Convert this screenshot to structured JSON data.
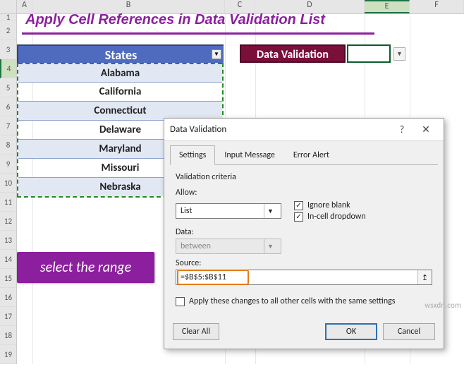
{
  "columns": [
    "A",
    "B",
    "C",
    "D",
    "E",
    "F"
  ],
  "rows": [
    "1",
    "2",
    "3",
    "4",
    "5",
    "6",
    "7",
    "8",
    "9",
    "10",
    "11",
    "12",
    "13",
    "14",
    "15",
    "16",
    "17",
    "18",
    "19"
  ],
  "selected_col": "E",
  "selected_row": "4",
  "title": "Apply Cell References in Data Validation List",
  "states": {
    "header": "States",
    "items": [
      "Alabama",
      "California",
      "Connecticut",
      "Delaware",
      "Maryland",
      "Missouri",
      "Nebraska"
    ]
  },
  "dv_label": "Data Validation",
  "range_hint": "select the range",
  "dialog": {
    "title": "Data Validation",
    "help": "?",
    "close": "✕",
    "tabs": {
      "settings": "Settings",
      "input_msg": "Input Message",
      "error_alert": "Error Alert"
    },
    "active_tab": "settings",
    "criteria_title": "Validation criteria",
    "allow_label": "Allow:",
    "allow_value": "List",
    "data_label": "Data:",
    "data_value": "between",
    "ignore_blank": {
      "label": "Ignore blank",
      "checked": true
    },
    "in_cell_dd": {
      "label": "In-cell dropdown",
      "checked": true
    },
    "source_label": "Source:",
    "source_value": "=$B$5:$B$11",
    "apply_other": {
      "label": "Apply these changes to all other cells with the same settings",
      "checked": false
    },
    "buttons": {
      "clear_all": "Clear All",
      "ok": "OK",
      "cancel": "Cancel"
    }
  },
  "watermark": "wsxdn.com"
}
